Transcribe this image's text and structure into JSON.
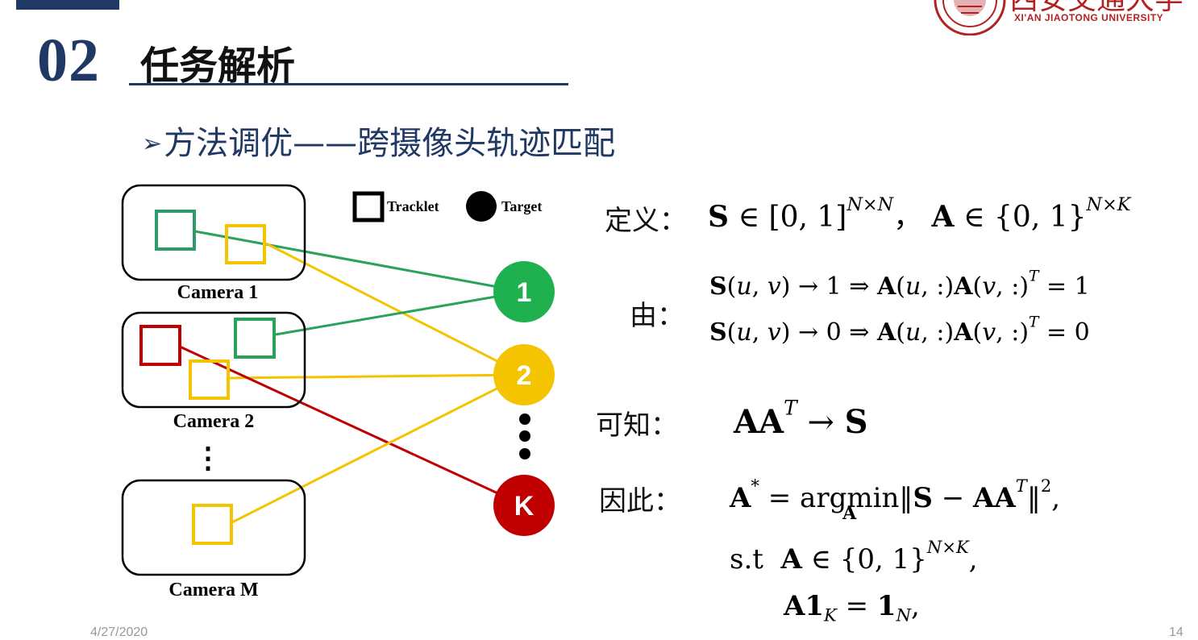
{
  "header": {
    "section_number": "02",
    "section_title": "任务解析",
    "logo_script": "西安交通大学",
    "logo_en": "XI'AN JIAOTONG UNIVERSITY"
  },
  "subtitle": {
    "arrow": "➢",
    "text": "方法调优——跨摄像头轨迹匹配"
  },
  "diagram": {
    "legend": {
      "tracklet": "Tracklet",
      "target": "Target"
    },
    "cameras": [
      "Camera 1",
      "Camera 2",
      "Camera M"
    ],
    "camera_dots": "⋮",
    "targets": [
      "1",
      "2",
      "K"
    ],
    "colors": {
      "green": "#28a35a",
      "yellow": "#f5c400",
      "red": "#c00000",
      "green_box": "#2e9b6a"
    }
  },
  "formulas": {
    "define_label": "定义：",
    "by_label": "由：",
    "know_label": "可知：",
    "therefore_label": "因此：",
    "st": "s.t"
  },
  "footer": {
    "date": "4/27/2020",
    "page": "14"
  }
}
